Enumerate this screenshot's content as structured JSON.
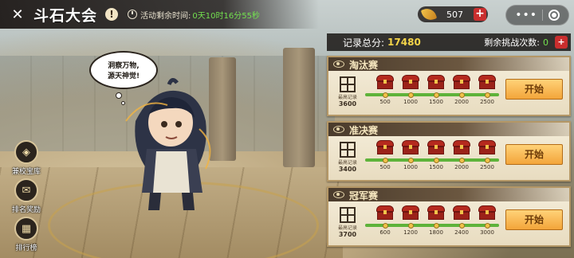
{
  "title_bar": {
    "back_icon": "back-arrow-icon",
    "title": "斗石大会",
    "warning_symbol": "!",
    "timer_label": "活动剩余时间:",
    "timer_value": "0天10时16分55秒"
  },
  "status": {
    "currency_icon": "gold-leaf-icon",
    "currency_value": "507",
    "currency_plus": "+"
  },
  "system_capsule": {
    "menu_icon": "more-dots-icon",
    "close_icon": "target-icon"
  },
  "record": {
    "total_label": "记录总分:",
    "total_value": "17480",
    "remain_label": "剩余挑战次数:",
    "remain_value": "0",
    "remain_plus": "+"
  },
  "speech": {
    "line1": "洞察万物,",
    "line2": "源天神觉!"
  },
  "side_menu": [
    {
      "label": "兼校宝库",
      "icon": "treasure-icon",
      "glyph": "◈"
    },
    {
      "label": "排名奖励",
      "icon": "reward-icon",
      "glyph": "✉"
    },
    {
      "label": "排行榜",
      "icon": "leaderboard-icon",
      "glyph": "▦"
    }
  ],
  "stages": [
    {
      "title": "淘汰赛",
      "score_label": "最高记录",
      "score_value": "3600",
      "progress": 1.0,
      "rewards": [
        "500",
        "1000",
        "1500",
        "2000",
        "2500"
      ],
      "button": "开始"
    },
    {
      "title": "准决赛",
      "score_label": "最高记录",
      "score_value": "3400",
      "progress": 1.0,
      "rewards": [
        "500",
        "1000",
        "1500",
        "2000",
        "2500"
      ],
      "button": "开始"
    },
    {
      "title": "冠军赛",
      "score_label": "最高记录",
      "score_value": "3700",
      "progress": 1.0,
      "rewards": [
        "600",
        "1200",
        "1800",
        "2400",
        "3000"
      ],
      "button": "开始"
    }
  ],
  "colors": {
    "accent_green": "#73e04f",
    "accent_gold": "#f5d549",
    "plus_red": "#c92e2e",
    "button_orange": "#f3a53a"
  }
}
